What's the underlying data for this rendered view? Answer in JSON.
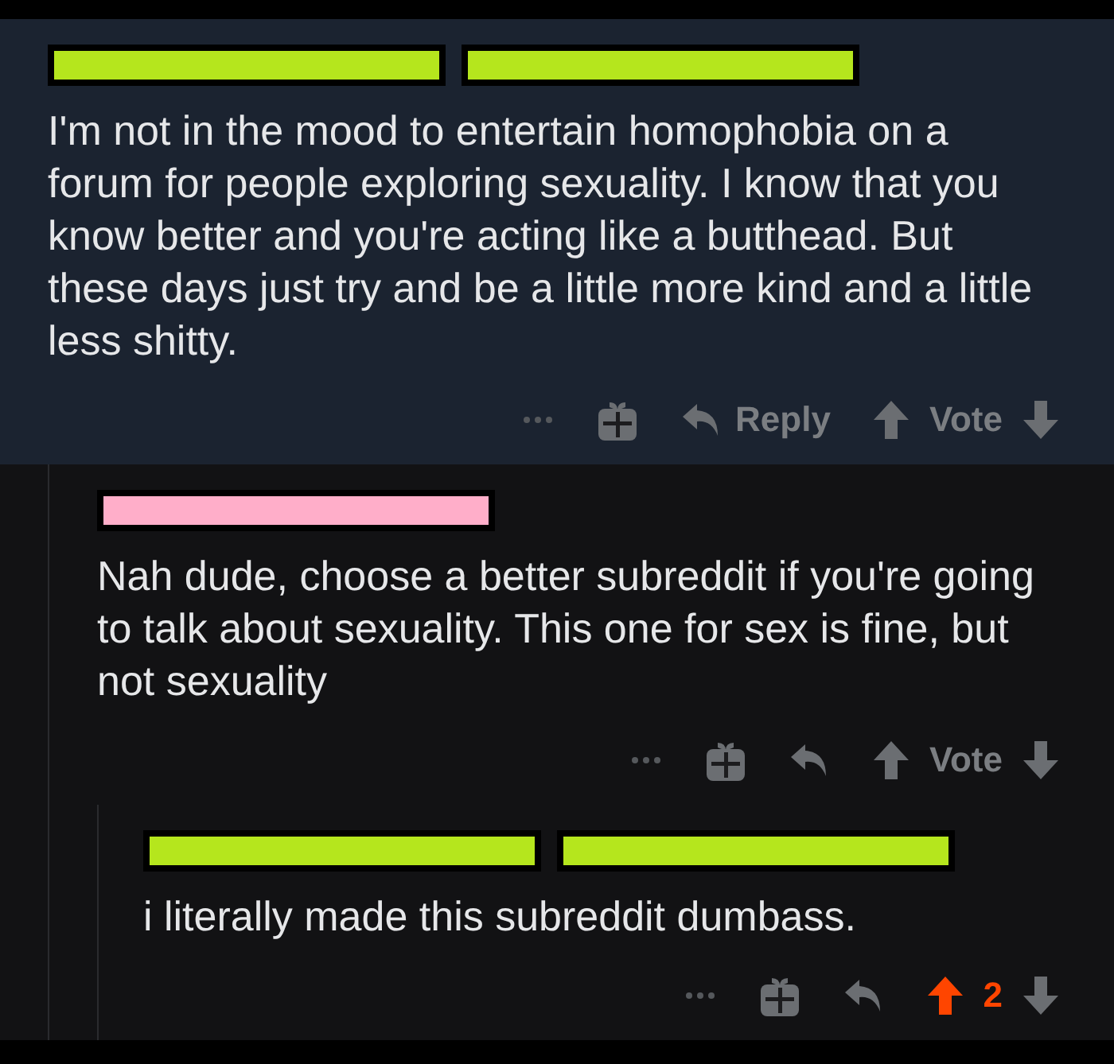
{
  "comments": [
    {
      "highlighted": true,
      "redactions": [
        {
          "color": "#b5e61d"
        },
        {
          "color": "#b5e61d"
        }
      ],
      "text": "I'm not in the mood to entertain homophobia on a forum for people exploring sexuality. I know that you know better and you're acting like a butthead. But these days just try and be a little more kind and a little less shitty.",
      "reply_label": "Reply",
      "vote_label": "Vote",
      "upvoted": false,
      "children": [
        {
          "highlighted": false,
          "redactions": [
            {
              "color": "#ffaec9"
            }
          ],
          "text": "Nah dude, choose a better subreddit if you're going to talk about sexuality. This one for sex is fine, but not sexuality",
          "vote_label": "Vote",
          "upvoted": false,
          "children": [
            {
              "highlighted": false,
              "redactions": [
                {
                  "color": "#b5e61d"
                },
                {
                  "color": "#b5e61d"
                }
              ],
              "text": "i literally made this subreddit dumbass.",
              "vote_label": "2",
              "upvoted": true
            }
          ]
        }
      ]
    }
  ]
}
